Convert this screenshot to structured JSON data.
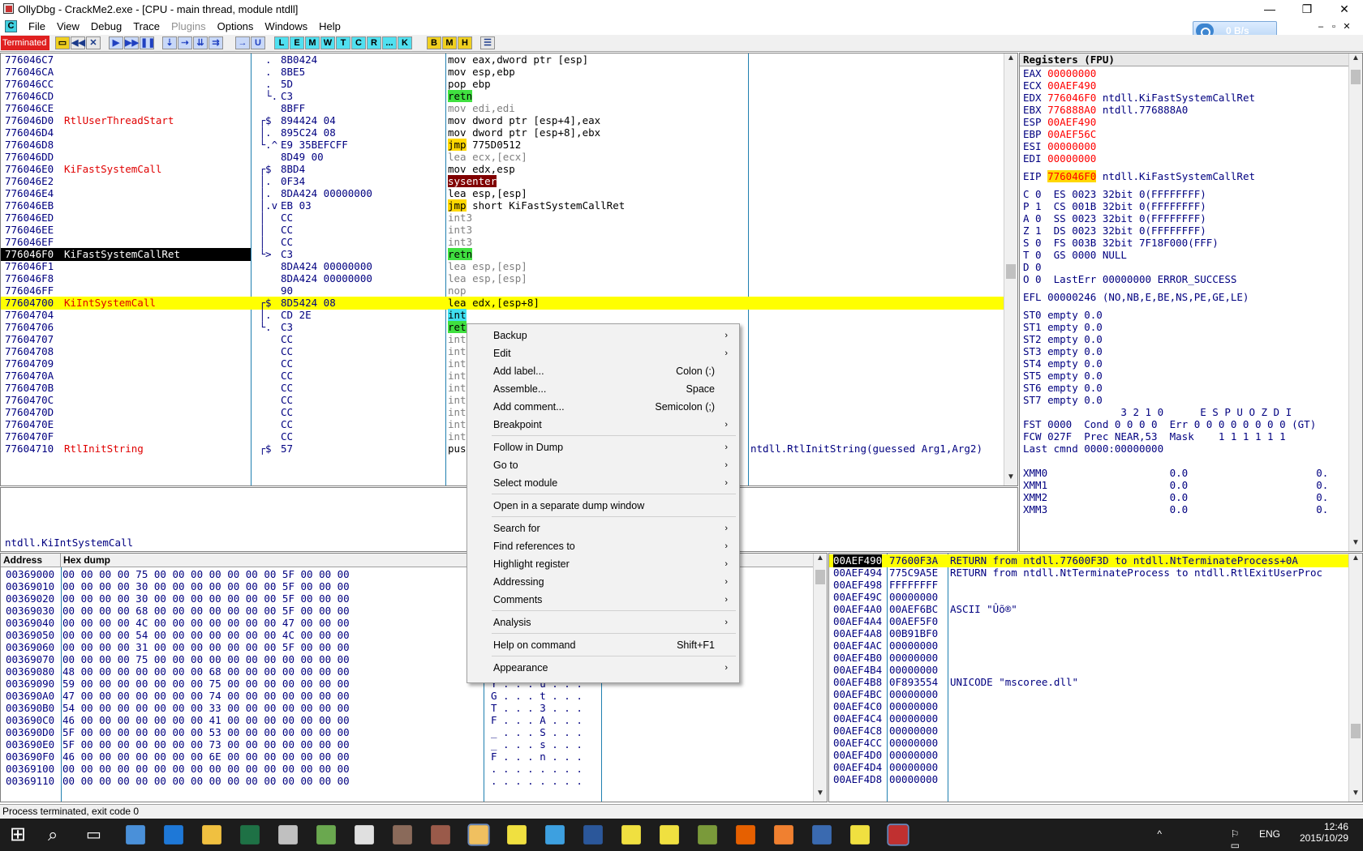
{
  "window": {
    "title": "OllyDbg - CrackMe2.exe - [CPU - main thread, module ntdll]",
    "controls": [
      "—",
      "❐",
      "✕"
    ]
  },
  "menu": [
    "File",
    "View",
    "Debug",
    "Trace",
    "Plugins",
    "Options",
    "Windows",
    "Help"
  ],
  "net_widget": {
    "speed": "0 B/s"
  },
  "toolbar": {
    "status": "Terminated",
    "letters": [
      "L",
      "E",
      "M",
      "W",
      "T",
      "C",
      "R",
      "...",
      "K",
      "B",
      "M",
      "H"
    ]
  },
  "disasm": [
    {
      "addr": "776046C7",
      "label": "",
      "br": "  .",
      "hex": "8B0424",
      "dis": [
        [
          "mov eax,dword ptr [esp]",
          ""
        ]
      ],
      "cmt": ""
    },
    {
      "addr": "776046CA",
      "label": "",
      "br": "  .",
      "hex": "8BE5",
      "dis": [
        [
          "mov esp,ebp",
          ""
        ]
      ],
      "cmt": ""
    },
    {
      "addr": "776046CC",
      "label": "",
      "br": "  .",
      "hex": "5D",
      "dis": [
        [
          "pop ebp",
          ""
        ]
      ],
      "cmt": ""
    },
    {
      "addr": "776046CD",
      "label": "",
      "br": "  └.",
      "hex": "C3",
      "dis": [
        [
          "retn",
          "kw-green"
        ]
      ],
      "cmt": ""
    },
    {
      "addr": "776046CE",
      "label": "",
      "br": "",
      "hex": "8BFF",
      "dis": [
        [
          "mov edi,edi",
          "kw-gray"
        ]
      ],
      "cmt": ""
    },
    {
      "addr": "776046D0",
      "label": "RtlUserThreadStart",
      "br": " ┌$",
      "hex": "894424 04",
      "dis": [
        [
          "mov dword ptr [esp+4],eax",
          ""
        ]
      ],
      "cmt": ""
    },
    {
      "addr": "776046D4",
      "label": "",
      "br": " │.",
      "hex": "895C24 08",
      "dis": [
        [
          "mov dword ptr [esp+8],ebx",
          ""
        ]
      ],
      "cmt": ""
    },
    {
      "addr": "776046D8",
      "label": "",
      "br": " └.^",
      "hex": "E9 35BEFCFF",
      "dis": [
        [
          "jmp",
          "kw-yel"
        ],
        [
          " 775D0512",
          ""
        ]
      ],
      "cmt": ""
    },
    {
      "addr": "776046DD",
      "label": "",
      "br": "",
      "hex": "8D49 00",
      "dis": [
        [
          "lea ecx,[ecx]",
          "kw-gray"
        ]
      ],
      "cmt": ""
    },
    {
      "addr": "776046E0",
      "label": "KiFastSystemCall",
      "br": " ┌$",
      "hex": "8BD4",
      "dis": [
        [
          "mov edx,esp",
          ""
        ]
      ],
      "cmt": ""
    },
    {
      "addr": "776046E2",
      "label": "",
      "br": " │.",
      "hex": "0F34",
      "dis": [
        [
          "sysenter",
          "kw-red"
        ]
      ],
      "cmt": ""
    },
    {
      "addr": "776046E4",
      "label": "",
      "br": " │.",
      "hex": "8DA424 00000000",
      "dis": [
        [
          "lea esp,[esp]",
          ""
        ]
      ],
      "cmt": ""
    },
    {
      "addr": "776046EB",
      "label": "",
      "br": " │.v",
      "hex": "EB 03",
      "dis": [
        [
          "jmp",
          "kw-yel"
        ],
        [
          " short KiFastSystemCallRet",
          ""
        ]
      ],
      "cmt": ""
    },
    {
      "addr": "776046ED",
      "label": "",
      "br": " │",
      "hex": "CC",
      "dis": [
        [
          "int3",
          "kw-gray"
        ]
      ],
      "cmt": ""
    },
    {
      "addr": "776046EE",
      "label": "",
      "br": " │",
      "hex": "CC",
      "dis": [
        [
          "int3",
          "kw-gray"
        ]
      ],
      "cmt": ""
    },
    {
      "addr": "776046EF",
      "label": "",
      "br": " │",
      "hex": "CC",
      "dis": [
        [
          "int3",
          "kw-gray"
        ]
      ],
      "cmt": ""
    },
    {
      "addr": "776046F0",
      "label": "KiFastSystemCallRet",
      "br": " └>",
      "hex": "C3",
      "dis": [
        [
          "retn",
          "kw-green"
        ]
      ],
      "cmt": "",
      "hl": "blk"
    },
    {
      "addr": "776046F1",
      "label": "",
      "br": "",
      "hex": "8DA424 00000000",
      "dis": [
        [
          "lea esp,[esp]",
          "kw-gray"
        ]
      ],
      "cmt": ""
    },
    {
      "addr": "776046F8",
      "label": "",
      "br": "",
      "hex": "8DA424 00000000",
      "dis": [
        [
          "lea esp,[esp]",
          "kw-gray"
        ]
      ],
      "cmt": ""
    },
    {
      "addr": "776046FF",
      "label": "",
      "br": "",
      "hex": "90",
      "dis": [
        [
          "nop",
          "kw-gray"
        ]
      ],
      "cmt": ""
    },
    {
      "addr": "77604700",
      "label": "KiIntSystemCall",
      "br": " ┌$",
      "hex": "8D5424 08",
      "dis": [
        [
          "lea edx,[esp+8]",
          ""
        ]
      ],
      "cmt": "",
      "hl": "yel"
    },
    {
      "addr": "77604704",
      "label": "",
      "br": " │.",
      "hex": "CD 2E",
      "dis": [
        [
          "int",
          "kw-cyan"
        ]
      ],
      "cmt": ""
    },
    {
      "addr": "77604706",
      "label": "",
      "br": " └.",
      "hex": "C3",
      "dis": [
        [
          "ret",
          "kw-green"
        ]
      ],
      "cmt": ""
    },
    {
      "addr": "77604707",
      "label": "",
      "br": "",
      "hex": "CC",
      "dis": [
        [
          "int",
          "kw-gray"
        ]
      ],
      "cmt": ""
    },
    {
      "addr": "77604708",
      "label": "",
      "br": "",
      "hex": "CC",
      "dis": [
        [
          "int",
          "kw-gray"
        ]
      ],
      "cmt": ""
    },
    {
      "addr": "77604709",
      "label": "",
      "br": "",
      "hex": "CC",
      "dis": [
        [
          "int",
          "kw-gray"
        ]
      ],
      "cmt": ""
    },
    {
      "addr": "7760470A",
      "label": "",
      "br": "",
      "hex": "CC",
      "dis": [
        [
          "int",
          "kw-gray"
        ]
      ],
      "cmt": ""
    },
    {
      "addr": "7760470B",
      "label": "",
      "br": "",
      "hex": "CC",
      "dis": [
        [
          "int",
          "kw-gray"
        ]
      ],
      "cmt": ""
    },
    {
      "addr": "7760470C",
      "label": "",
      "br": "",
      "hex": "CC",
      "dis": [
        [
          "int",
          "kw-gray"
        ]
      ],
      "cmt": ""
    },
    {
      "addr": "7760470D",
      "label": "",
      "br": "",
      "hex": "CC",
      "dis": [
        [
          "int",
          "kw-gray"
        ]
      ],
      "cmt": ""
    },
    {
      "addr": "7760470E",
      "label": "",
      "br": "",
      "hex": "CC",
      "dis": [
        [
          "int",
          "kw-gray"
        ]
      ],
      "cmt": ""
    },
    {
      "addr": "7760470F",
      "label": "",
      "br": "",
      "hex": "CC",
      "dis": [
        [
          "int",
          "kw-gray"
        ]
      ],
      "cmt": ""
    },
    {
      "addr": "77604710",
      "label": "RtlInitString",
      "br": " ┌$",
      "hex": "57",
      "dis": [
        [
          "pus",
          ""
        ]
      ],
      "cmt": "ntdll.RtlInitString(guessed Arg1,Arg2)"
    }
  ],
  "info_pane": "ntdll.KiIntSystemCall",
  "registers": {
    "header": "Registers (FPU)",
    "gp": [
      {
        "name": "EAX",
        "val": "00000000",
        "cmt": ""
      },
      {
        "name": "ECX",
        "val": "00AEF490",
        "cmt": ""
      },
      {
        "name": "EDX",
        "val": "776046F0",
        "cmt": "ntdll.KiFastSystemCallRet"
      },
      {
        "name": "EBX",
        "val": "776888A0",
        "cmt": "ntdll.776888A0"
      },
      {
        "name": "ESP",
        "val": "00AEF490",
        "cmt": ""
      },
      {
        "name": "EBP",
        "val": "00AEF56C",
        "cmt": ""
      },
      {
        "name": "ESI",
        "val": "00000000",
        "cmt": ""
      },
      {
        "name": "EDI",
        "val": "00000000",
        "cmt": ""
      }
    ],
    "eip": {
      "name": "EIP",
      "val": "776046F0",
      "cmt": "ntdll.KiFastSystemCallRet"
    },
    "flags": [
      "C 0  ES 0023 32bit 0(FFFFFFFF)",
      "P 1  CS 001B 32bit 0(FFFFFFFF)",
      "A 0  SS 0023 32bit 0(FFFFFFFF)",
      "Z 1  DS 0023 32bit 0(FFFFFFFF)",
      "S 0  FS 003B 32bit 7F18F000(FFF)",
      "T 0  GS 0000 NULL",
      "D 0",
      "O 0  LastErr 00000000 ERROR_SUCCESS"
    ],
    "efl": "EFL 00000246 (NO,NB,E,BE,NS,PE,GE,LE)",
    "fpu": [
      "ST0 empty 0.0",
      "ST1 empty 0.0",
      "ST2 empty 0.0",
      "ST3 empty 0.0",
      "ST4 empty 0.0",
      "ST5 empty 0.0",
      "ST6 empty 0.0",
      "ST7 empty 0.0"
    ],
    "fpu_hdr": "                3 2 1 0      E S P U O Z D I",
    "fst": "FST 0000  Cond 0 0 0 0  Err 0 0 0 0 0 0 0 0 (GT)",
    "fcw": "FCW 027F  Prec NEAR,53  Mask    1 1 1 1 1 1",
    "lastcmnd": "Last cmnd 0000:00000000",
    "xmm": [
      "XMM0                    0.0                     0.",
      "XMM1                    0.0                     0.",
      "XMM2                    0.0                     0.",
      "XMM3                    0.0                     0."
    ]
  },
  "dump": {
    "headers": [
      "Address",
      "Hex dump"
    ],
    "rows": [
      {
        "addr": "00369000",
        "hex": "00 00 00 00 75 00 00 00 00 00 00 00 5F 00 00 00",
        "asc": ""
      },
      {
        "addr": "00369010",
        "hex": "00 00 00 00 30 00 00 00 00 00 00 00 5F 00 00 00",
        "asc": ""
      },
      {
        "addr": "00369020",
        "hex": "00 00 00 00 30 00 00 00 00 00 00 00 5F 00 00 00",
        "asc": ""
      },
      {
        "addr": "00369030",
        "hex": "00 00 00 00 68 00 00 00 00 00 00 00 5F 00 00 00",
        "asc": ""
      },
      {
        "addr": "00369040",
        "hex": "00 00 00 00 4C 00 00 00 00 00 00 00 47 00 00 00",
        "asc": ""
      },
      {
        "addr": "00369050",
        "hex": "00 00 00 00 54 00 00 00 00 00 00 00 4C 00 00 00",
        "asc": ""
      },
      {
        "addr": "00369060",
        "hex": "00 00 00 00 31 00 00 00 00 00 00 00 5F 00 00 00",
        "asc": ""
      },
      {
        "addr": "00369070",
        "hex": "00 00 00 00 75 00 00 00 00 00 00 00 00 00 00 00",
        "asc": ""
      },
      {
        "addr": "00369080",
        "hex": "48 00 00 00 00 00 00 00 68 00 00 00 00 00 00 00",
        "asc": ""
      },
      {
        "addr": "00369090",
        "hex": "59 00 00 00 00 00 00 00 75 00 00 00 00 00 00 00",
        "asc": "Y . . . u . . ."
      },
      {
        "addr": "003690A0",
        "hex": "47 00 00 00 00 00 00 00 74 00 00 00 00 00 00 00",
        "asc": "G . . . t . . ."
      },
      {
        "addr": "003690B0",
        "hex": "54 00 00 00 00 00 00 00 33 00 00 00 00 00 00 00",
        "asc": "T . . . 3 . . ."
      },
      {
        "addr": "003690C0",
        "hex": "46 00 00 00 00 00 00 00 41 00 00 00 00 00 00 00",
        "asc": "F . . . A . . ."
      },
      {
        "addr": "003690D0",
        "hex": "5F 00 00 00 00 00 00 00 53 00 00 00 00 00 00 00",
        "asc": "_ . . . S . . ."
      },
      {
        "addr": "003690E0",
        "hex": "5F 00 00 00 00 00 00 00 73 00 00 00 00 00 00 00",
        "asc": "_ . . . s . . ."
      },
      {
        "addr": "003690F0",
        "hex": "46 00 00 00 00 00 00 00 6E 00 00 00 00 00 00 00",
        "asc": "F . . . n . . ."
      },
      {
        "addr": "00369100",
        "hex": "00 00 00 00 00 00 00 00 00 00 00 00 00 00 00 00",
        "asc": ". . . . . . . ."
      },
      {
        "addr": "00369110",
        "hex": "00 00 00 00 00 00 00 00 00 00 00 00 00 00 00 00",
        "asc": ". . . . . . . ."
      }
    ]
  },
  "stack": [
    {
      "addr": "00AEF490",
      "val": "77600F3A",
      "cmt": "RETURN from ntdll.77600F3D to ntdll.NtTerminateProcess+0A",
      "hl": true
    },
    {
      "addr": "00AEF494",
      "val": "775C9A5E",
      "cmt": "RETURN from ntdll.NtTerminateProcess to ntdll.RtlExitUserProc"
    },
    {
      "addr": "00AEF498",
      "val": "FFFFFFFF",
      "cmt": ""
    },
    {
      "addr": "00AEF49C",
      "val": "00000000",
      "cmt": ""
    },
    {
      "addr": "00AEF4A0",
      "val": "00AEF6BC",
      "cmt": "ASCII \"Ûõ®\""
    },
    {
      "addr": "00AEF4A4",
      "val": "00AEF5F0",
      "cmt": ""
    },
    {
      "addr": "00AEF4A8",
      "val": "00B91BF0",
      "cmt": ""
    },
    {
      "addr": "00AEF4AC",
      "val": "00000000",
      "cmt": ""
    },
    {
      "addr": "00AEF4B0",
      "val": "00000000",
      "cmt": ""
    },
    {
      "addr": "00AEF4B4",
      "val": "00000000",
      "cmt": ""
    },
    {
      "addr": "00AEF4B8",
      "val": "0F893554",
      "cmt": "UNICODE \"mscoree.dll\""
    },
    {
      "addr": "00AEF4BC",
      "val": "00000000",
      "cmt": ""
    },
    {
      "addr": "00AEF4C0",
      "val": "00000000",
      "cmt": ""
    },
    {
      "addr": "00AEF4C4",
      "val": "00000000",
      "cmt": ""
    },
    {
      "addr": "00AEF4C8",
      "val": "00000000",
      "cmt": ""
    },
    {
      "addr": "00AEF4CC",
      "val": "00000000",
      "cmt": ""
    },
    {
      "addr": "00AEF4D0",
      "val": "00000000",
      "cmt": ""
    },
    {
      "addr": "00AEF4D4",
      "val": "00000000",
      "cmt": ""
    },
    {
      "addr": "00AEF4D8",
      "val": "00000000",
      "cmt": ""
    }
  ],
  "context_menu": [
    {
      "label": "Backup",
      "key": "",
      "sub": true
    },
    {
      "label": "Edit",
      "key": "",
      "sub": true
    },
    {
      "label": "Add label...",
      "key": "Colon (:)",
      "sub": false
    },
    {
      "label": "Assemble...",
      "key": "Space",
      "sub": false
    },
    {
      "label": "Add comment...",
      "key": "Semicolon (;)",
      "sub": false
    },
    {
      "label": "Breakpoint",
      "key": "",
      "sub": true,
      "sep_after": true
    },
    {
      "label": "Follow in Dump",
      "key": "",
      "sub": true
    },
    {
      "label": "Go to",
      "key": "",
      "sub": true
    },
    {
      "label": "Select module",
      "key": "",
      "sub": true,
      "sep_after": true
    },
    {
      "label": "Open in a separate dump window",
      "key": "",
      "sub": false,
      "sep_after": true
    },
    {
      "label": "Search for",
      "key": "",
      "sub": true
    },
    {
      "label": "Find references to",
      "key": "",
      "sub": true
    },
    {
      "label": "Highlight register",
      "key": "",
      "sub": true
    },
    {
      "label": "Addressing",
      "key": "",
      "sub": true
    },
    {
      "label": "Comments",
      "key": "",
      "sub": true,
      "sep_after": true
    },
    {
      "label": "Analysis",
      "key": "",
      "sub": true,
      "sep_after": true
    },
    {
      "label": "Help on command",
      "key": "Shift+F1",
      "sub": false,
      "sep_after": true
    },
    {
      "label": "Appearance",
      "key": "",
      "sub": true
    }
  ],
  "statusbar": "Process terminated, exit code 0",
  "taskbar": {
    "time": "12:46",
    "date": "2015/10/29",
    "lang": "ENG",
    "apps": [
      "start-icon",
      "search-icon",
      "task-view-icon",
      "globe-icon",
      "edge-icon",
      "explorer-icon",
      "excel-icon",
      "app-icon",
      "notepad-icon",
      "search-app-icon",
      "photo-icon",
      "photo-icon",
      "mail-icon",
      "help-icon",
      "cloud-icon",
      "word-icon",
      "help-icon",
      "help-icon",
      "app-icon",
      "firefox-icon",
      "app-icon",
      "app-icon",
      "help-icon",
      "ollydbg-icon"
    ]
  }
}
